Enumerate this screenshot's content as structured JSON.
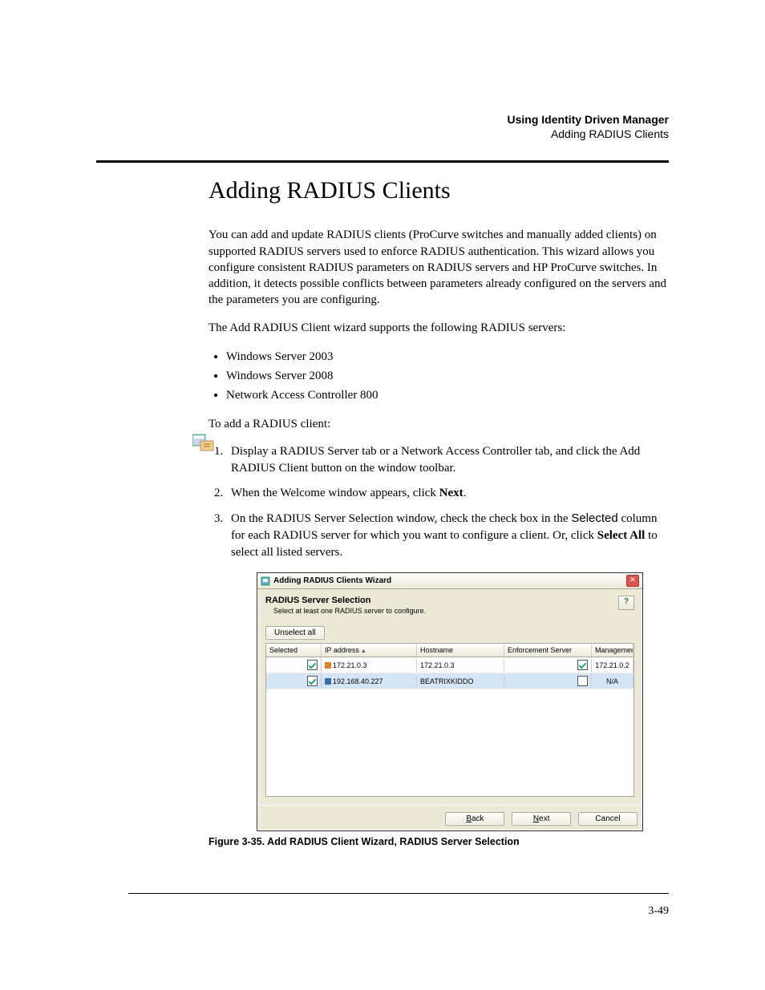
{
  "header": {
    "chapter": "Using Identity Driven Manager",
    "section": "Adding RADIUS Clients"
  },
  "title": "Adding RADIUS Clients",
  "intro_para": "You can add and update RADIUS clients (ProCurve switches and manually added clients) on supported RADIUS servers used to enforce RADIUS authentication. This wizard allows you configure consistent RADIUS parameters on RADIUS servers and HP ProCurve switches. In addition, it detects possible conflicts between parameters already configured on the servers and the parameters you are configuring.",
  "supports_line": "The Add RADIUS Client wizard supports the following RADIUS servers:",
  "bullets": {
    "0": "Windows Server 2003",
    "1": "Windows Server 2008",
    "2": "Network Access Controller 800"
  },
  "to_add_line": "To add a RADIUS client:",
  "steps": {
    "0_pre": "Display a RADIUS Server tab or a Network Access Controller tab, and click the Add RADIUS Client button on the window toolbar.",
    "1_pre": "When the Welcome window appears, click ",
    "1_bold": "Next",
    "1_post": ".",
    "2_pre": "On the RADIUS Server Selection window, check the check box in the ",
    "2_sans": "Selected",
    "2_mid": " column for each RADIUS server for which you want to configure a client. Or, click ",
    "2_bold": "Select All",
    "2_post": " to select all listed servers."
  },
  "wizard": {
    "title": "Adding RADIUS Clients Wizard",
    "heading": "RADIUS Server Selection",
    "sub": "Select at least one RADIUS server to configure.",
    "unselect_label": "Unselect all",
    "help_label": "?",
    "close_label": "✕",
    "columns": {
      "selected": "Selected",
      "ip": "IP address",
      "hostname": "Hostname",
      "enforcement": "Enforcement Server",
      "mgmt": "Management Serve..."
    },
    "rows": {
      "0": {
        "ip": "172.21.0.3",
        "hostname": "172.21.0.3",
        "mgmt": "172.21.0.2",
        "sel": true,
        "enf": true,
        "icon": "orange"
      },
      "1": {
        "ip": "192.168.40.227",
        "hostname": "BEATRIXKIDDO",
        "mgmt": "N/A",
        "sel": true,
        "enf": false,
        "icon": "blue"
      }
    },
    "buttons": {
      "back": "Back",
      "next": "Next",
      "cancel": "Cancel"
    }
  },
  "figure_caption": "Figure 3-35. Add RADIUS Client Wizard, RADIUS Server Selection",
  "page_number": "3-49"
}
